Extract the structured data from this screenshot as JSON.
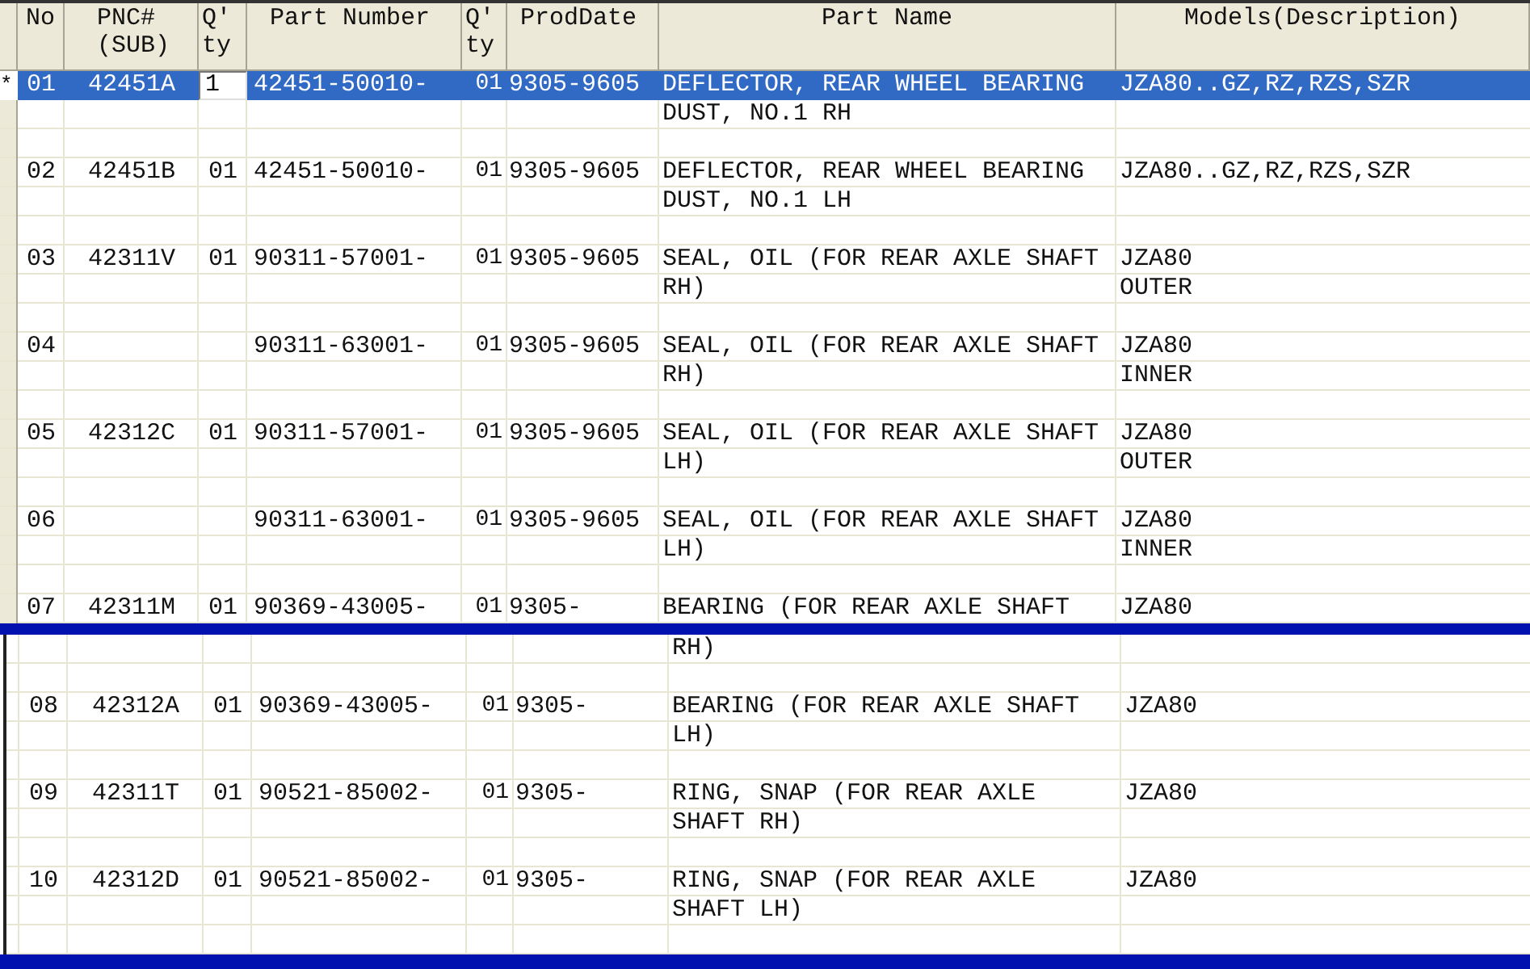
{
  "columns": [
    {
      "label": "No"
    },
    {
      "label": "PNC#\n(SUB)"
    },
    {
      "label": "Q'\nty"
    },
    {
      "label": "Part Number"
    },
    {
      "label": "Q'\nty"
    },
    {
      "label": "ProdDate"
    },
    {
      "label": "Part Name"
    },
    {
      "label": "Models(Description)"
    }
  ],
  "upper_pane": {
    "rows": [
      {
        "marker": "*",
        "selected": true,
        "editing": true,
        "no": "01",
        "pnc": "42451A",
        "qty": "1",
        "part_number": "42451-50010-",
        "qty2": "01",
        "prod_date": "9305-9605",
        "part_name": [
          "DEFLECTOR, REAR WHEEL BEARING",
          "DUST, NO.1 RH"
        ],
        "models": [
          "JZA80..GZ,RZ,RZS,SZR"
        ]
      },
      {
        "selected": false,
        "editing": false,
        "no": "02",
        "pnc": "42451B",
        "qty": "01",
        "part_number": "42451-50010-",
        "qty2": "01",
        "prod_date": "9305-9605",
        "part_name": [
          "DEFLECTOR, REAR WHEEL BEARING",
          "DUST, NO.1 LH"
        ],
        "models": [
          "JZA80..GZ,RZ,RZS,SZR"
        ]
      },
      {
        "selected": false,
        "editing": false,
        "no": "03",
        "pnc": "42311V",
        "qty": "01",
        "part_number": "90311-57001-",
        "qty2": "01",
        "prod_date": "9305-9605",
        "part_name": [
          "SEAL, OIL (FOR REAR AXLE SHAFT",
          "RH)"
        ],
        "models": [
          "JZA80",
          "OUTER"
        ]
      },
      {
        "selected": false,
        "editing": false,
        "no": "04",
        "part_number": "90311-63001-",
        "qty2": "01",
        "prod_date": "9305-9605",
        "part_name": [
          "SEAL, OIL (FOR REAR AXLE SHAFT",
          "RH)"
        ],
        "models": [
          "JZA80",
          "INNER"
        ]
      },
      {
        "selected": false,
        "editing": false,
        "no": "05",
        "pnc": "42312C",
        "qty": "01",
        "part_number": "90311-57001-",
        "qty2": "01",
        "prod_date": "9305-9605",
        "part_name": [
          "SEAL, OIL (FOR REAR AXLE SHAFT",
          "LH)"
        ],
        "models": [
          "JZA80",
          "OUTER"
        ]
      },
      {
        "selected": false,
        "editing": false,
        "no": "06",
        "part_number": "90311-63001-",
        "qty2": "01",
        "prod_date": "9305-9605",
        "part_name": [
          "SEAL, OIL (FOR REAR AXLE SHAFT",
          "LH)"
        ],
        "models": [
          "JZA80",
          "INNER"
        ]
      },
      {
        "selected": false,
        "editing": false,
        "no": "07",
        "pnc": "42311M",
        "qty": "01",
        "part_number": "90369-43005-",
        "qty2": "01",
        "prod_date": "9305-",
        "part_name": [
          "BEARING (FOR REAR AXLE SHAFT"
        ],
        "models": [
          "JZA80"
        ]
      }
    ]
  },
  "lower_pane": {
    "rows": [
      {
        "selected": false,
        "editing": false,
        "part_name": [
          "RH)"
        ]
      },
      {
        "selected": false,
        "editing": false,
        "no": "08",
        "pnc": "42312A",
        "qty": "01",
        "part_number": "90369-43005-",
        "qty2": "01",
        "prod_date": "9305-",
        "part_name": [
          "BEARING (FOR REAR AXLE SHAFT",
          "LH)"
        ],
        "models": [
          "JZA80"
        ]
      },
      {
        "selected": false,
        "editing": false,
        "no": "09",
        "pnc": "42311T",
        "qty": "01",
        "part_number": "90521-85002-",
        "qty2": "01",
        "prod_date": "9305-",
        "part_name": [
          "RING, SNAP (FOR REAR AXLE",
          "SHAFT RH)"
        ],
        "models": [
          "JZA80"
        ]
      },
      {
        "selected": false,
        "editing": false,
        "no": "10",
        "pnc": "42312D",
        "qty": "01",
        "part_number": "90521-85002-",
        "qty2": "01",
        "prod_date": "9305-",
        "part_name": [
          "RING, SNAP (FOR REAR AXLE",
          "SHAFT LH)"
        ],
        "models": [
          "JZA80"
        ]
      }
    ]
  }
}
